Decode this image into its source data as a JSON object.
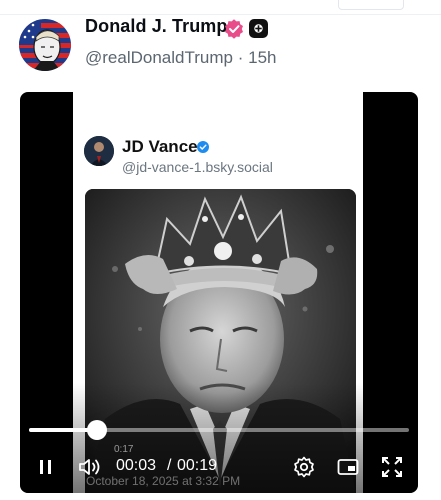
{
  "post": {
    "author_name": "Donald J. Trump",
    "handle": "@realDonaldTrump",
    "separator": "·",
    "time_ago": "15h"
  },
  "embedded_post": {
    "author_name": "JD Vance",
    "handle": "@jd-vance-1.bsky.social"
  },
  "player": {
    "progress_fraction": 0.18,
    "current_time": "00:03",
    "time_separator": "/",
    "duration": "00:19",
    "ghost_time": "0:17",
    "ghost_date": "October 18, 2025 at 3:32 PM",
    "icons": [
      "pause-icon",
      "volume-icon",
      "settings-icon",
      "subtitles-icon",
      "fullscreen-icon"
    ]
  },
  "colors": {
    "verified_badge": "#e84d8a",
    "inner_check": "#1d8cf0",
    "handle_gray": "#5b6670"
  }
}
